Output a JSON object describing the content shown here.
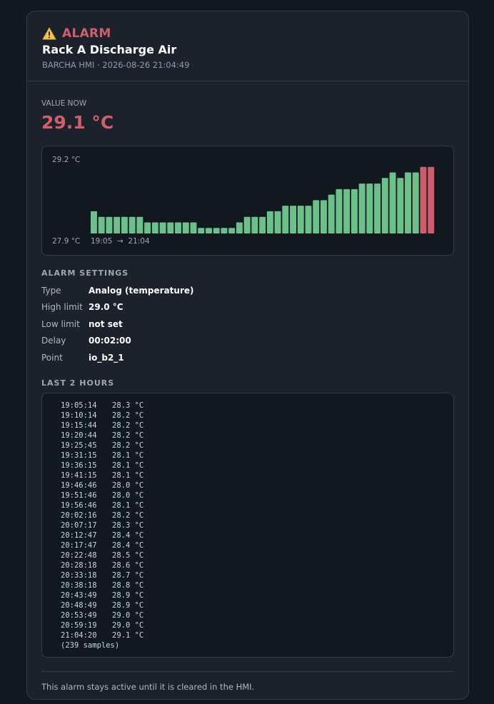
{
  "header": {
    "alarm_label": "ALARM",
    "title": "Rack A Discharge Air",
    "subtitle": "BARCHA HMI · 2026-08-26 21:04:49"
  },
  "value": {
    "label": "VALUE NOW",
    "current": "29.1 °C"
  },
  "chart_data": {
    "type": "bar",
    "y_max_label": "29.2 °C",
    "y_min_label": "27.9 °C",
    "x_range_label": "19:05  →  21:04",
    "ylim": [
      27.9,
      29.2
    ],
    "threshold": 29.0,
    "values": [
      28.3,
      28.2,
      28.2,
      28.2,
      28.2,
      28.2,
      28.2,
      28.1,
      28.1,
      28.1,
      28.1,
      28.1,
      28.1,
      28.1,
      28.0,
      28.0,
      28.0,
      28.0,
      28.0,
      28.1,
      28.2,
      28.2,
      28.2,
      28.3,
      28.3,
      28.4,
      28.4,
      28.4,
      28.4,
      28.5,
      28.5,
      28.6,
      28.7,
      28.7,
      28.7,
      28.8,
      28.8,
      28.8,
      28.9,
      29.0,
      28.9,
      29.0,
      29.0,
      29.1,
      29.1
    ],
    "colors": {
      "normal": "#6cc08a",
      "alarm": "#cf5b6b"
    }
  },
  "settings": {
    "title": "ALARM SETTINGS",
    "rows": [
      {
        "key": "Type",
        "value": "Analog (temperature)"
      },
      {
        "key": "High limit",
        "value": "29.0 °C"
      },
      {
        "key": "Low limit",
        "value": "not set"
      },
      {
        "key": "Delay",
        "value": "00:02:00"
      },
      {
        "key": "Point",
        "value": "io_b2_1"
      }
    ]
  },
  "log": {
    "title": "LAST 2 HOURS",
    "rows": [
      {
        "time": "19:05:14",
        "value": "28.3 °C"
      },
      {
        "time": "19:10:14",
        "value": "28.2 °C"
      },
      {
        "time": "19:15:44",
        "value": "28.2 °C"
      },
      {
        "time": "19:20:44",
        "value": "28.2 °C"
      },
      {
        "time": "19:25:45",
        "value": "28.2 °C"
      },
      {
        "time": "19:31:15",
        "value": "28.1 °C"
      },
      {
        "time": "19:36:15",
        "value": "28.1 °C"
      },
      {
        "time": "19:41:15",
        "value": "28.1 °C"
      },
      {
        "time": "19:46:46",
        "value": "28.0 °C"
      },
      {
        "time": "19:51:46",
        "value": "28.0 °C"
      },
      {
        "time": "19:56:46",
        "value": "28.1 °C"
      },
      {
        "time": "20:02:16",
        "value": "28.2 °C"
      },
      {
        "time": "20:07:17",
        "value": "28.3 °C"
      },
      {
        "time": "20:12:47",
        "value": "28.4 °C"
      },
      {
        "time": "20:17:47",
        "value": "28.4 °C"
      },
      {
        "time": "20:22:48",
        "value": "28.5 °C"
      },
      {
        "time": "20:28:18",
        "value": "28.6 °C"
      },
      {
        "time": "20:33:18",
        "value": "28.7 °C"
      },
      {
        "time": "20:38:18",
        "value": "28.8 °C"
      },
      {
        "time": "20:43:49",
        "value": "28.9 °C"
      },
      {
        "time": "20:48:49",
        "value": "28.9 °C"
      },
      {
        "time": "20:53:49",
        "value": "29.0 °C"
      },
      {
        "time": "20:59:19",
        "value": "29.0 °C"
      },
      {
        "time": "21:04:20",
        "value": "29.1 °C"
      }
    ],
    "sample_count": "(239 samples)"
  },
  "footer": {
    "note": "This alarm stays active until it is cleared in the HMI."
  },
  "colors": {
    "alarm": "#d15e6c",
    "background": "#121820",
    "card": "#1b222b"
  }
}
